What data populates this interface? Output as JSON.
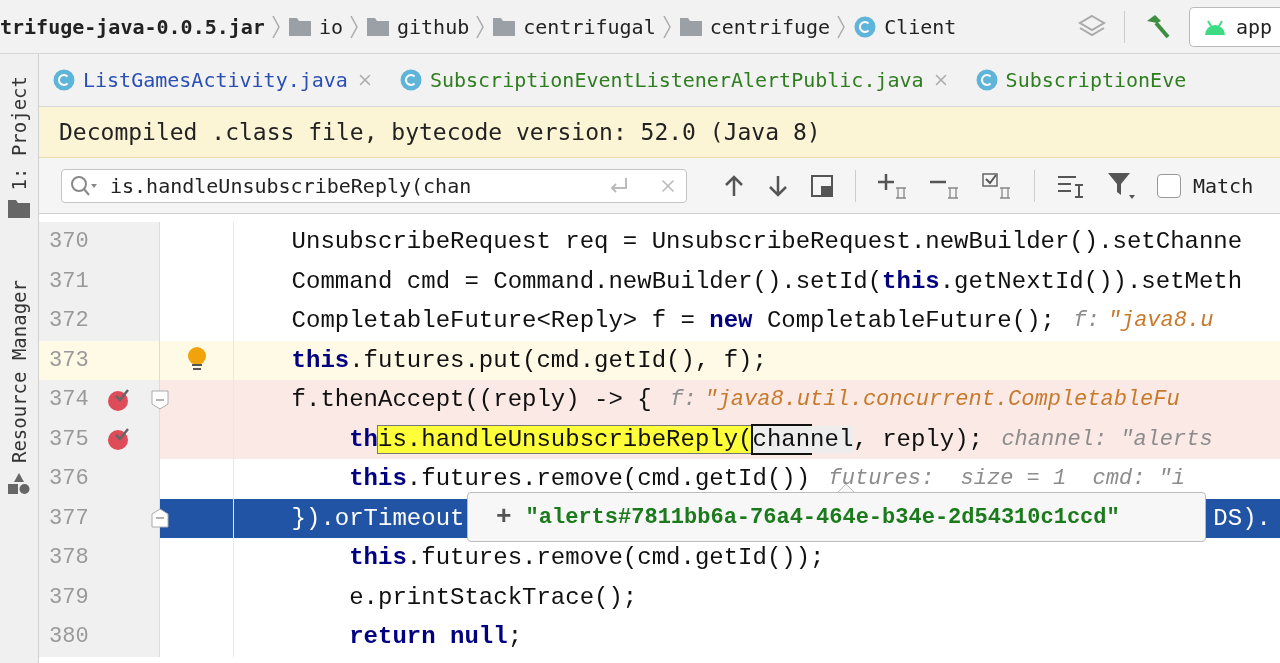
{
  "breadcrumbs": [
    {
      "kind": "jar",
      "label": "trifuge-java-0.0.5.jar"
    },
    {
      "kind": "folder",
      "label": "io"
    },
    {
      "kind": "folder",
      "label": "github"
    },
    {
      "kind": "folder",
      "label": "centrifugal"
    },
    {
      "kind": "folder",
      "label": "centrifuge"
    },
    {
      "kind": "class",
      "label": "Client"
    }
  ],
  "run_config": {
    "label": "app"
  },
  "sidebar": [
    {
      "kind": "project",
      "label": "1: Project"
    },
    {
      "kind": "resources",
      "label": "Resource Manager"
    }
  ],
  "tabs": [
    {
      "label": "ListGamesActivity.java",
      "color": "#2a4fb5",
      "closable": true
    },
    {
      "label": "SubscriptionEventListenerAlertPublic.java",
      "color": "#2e7d1f",
      "closable": true
    },
    {
      "label": "SubscriptionEve",
      "color": "#2e7d1f",
      "closable": false
    }
  ],
  "banner": {
    "text": "Decompiled .class file, bytecode version: 52.0 (Java 8)"
  },
  "search": {
    "value": "is.handleUnsubscribeReply(chan"
  },
  "match_case": {
    "label": "Match",
    "checked": false
  },
  "lines": [
    {
      "number": "370",
      "kind": "plain",
      "breakpoint": false,
      "bulb": false,
      "foldable": false,
      "tokens": [
        {
          "kind": "text",
          "text": "UnsubscribeRequest req = UnsubscribeRequest.newBuilder().setChanne"
        }
      ]
    },
    {
      "number": "371",
      "kind": "plain",
      "breakpoint": false,
      "bulb": false,
      "foldable": false,
      "tokens": [
        {
          "kind": "text",
          "text": "Command cmd = Command.newBuilder().setId("
        },
        {
          "kind": "keyword",
          "text": "this"
        },
        {
          "kind": "text",
          "text": ".getNextId()).setMeth"
        }
      ]
    },
    {
      "number": "372",
      "kind": "plain",
      "breakpoint": false,
      "bulb": false,
      "foldable": false,
      "tokens": [
        {
          "kind": "text",
          "text": "CompletableFuture<Reply> f = "
        },
        {
          "kind": "keyword",
          "text": "new"
        },
        {
          "kind": "text",
          "text": " CompletableFuture();"
        },
        {
          "kind": "hint_label",
          "text": "f:"
        },
        {
          "kind": "hint_value",
          "text": "\"java8.u"
        }
      ]
    },
    {
      "number": "373",
      "kind": "caret_line",
      "breakpoint": false,
      "bulb": true,
      "foldable": false,
      "tokens": [
        {
          "kind": "keyword",
          "text": "this"
        },
        {
          "kind": "text",
          "text": ".futures.put(cmd.getId(), f);"
        }
      ]
    },
    {
      "number": "374",
      "kind": "breakpoint",
      "breakpoint": true,
      "bulb": false,
      "foldable": true,
      "tokens": [
        {
          "kind": "text",
          "text": "f.thenAccept((reply) -> {"
        },
        {
          "kind": "hint_label",
          "text": "f:"
        },
        {
          "kind": "hint_value",
          "text": "\"java8.util.concurrent.CompletableFu"
        }
      ],
      "children": [
        {
          "number": "375",
          "kind": "breakpoint",
          "breakpoint": true,
          "bulb": false,
          "foldable": false,
          "tokens": [
            {
              "kind": "keyword",
              "text": "th"
            },
            {
              "kind": "match",
              "text": "is.handleUnsubscribeReply("
            },
            {
              "kind": "current",
              "text": "chan"
            },
            {
              "kind": "usage",
              "text": "nel"
            },
            {
              "kind": "text",
              "text": ", reply);"
            },
            {
              "kind": "hint_label",
              "text": "channel: \"alerts"
            }
          ]
        },
        {
          "number": "376",
          "kind": "plain",
          "breakpoint": false,
          "bulb": false,
          "foldable": false,
          "tokens": [
            {
              "kind": "keyword",
              "text": "this"
            },
            {
              "kind": "text",
              "text": ".futures.remove(cmd.getId())"
            },
            {
              "kind": "hint_label",
              "text": "futures:  size = 1  cmd: \"i"
            }
          ]
        }
      ]
    },
    {
      "number": "377",
      "kind": "selected",
      "breakpoint": false,
      "bulb": false,
      "foldable": true,
      "tokens": [
        {
          "kind": "text",
          "text": "}).orTimeout"
        },
        {
          "kind": "tail",
          "text": "DS)."
        }
      ],
      "children": [
        {
          "number": "378",
          "kind": "plain",
          "breakpoint": false,
          "bulb": false,
          "foldable": false,
          "tokens": [
            {
              "kind": "keyword",
              "text": "this"
            },
            {
              "kind": "text",
              "text": ".futures.remove(cmd.getId());"
            }
          ]
        },
        {
          "number": "379",
          "kind": "plain",
          "breakpoint": false,
          "bulb": false,
          "foldable": false,
          "tokens": [
            {
              "kind": "text",
              "text": "e.printStackTrace();"
            }
          ]
        },
        {
          "number": "380",
          "kind": "plain",
          "breakpoint": false,
          "bulb": false,
          "foldable": false,
          "tokens": [
            {
              "kind": "keyword",
              "text": "return null"
            },
            {
              "kind": "text",
              "text": ";"
            }
          ]
        }
      ]
    }
  ],
  "popup": {
    "expand": "+",
    "value": "\"alerts#7811bb6a-76a4-464e-b34e-2d54310c1ccd\""
  }
}
